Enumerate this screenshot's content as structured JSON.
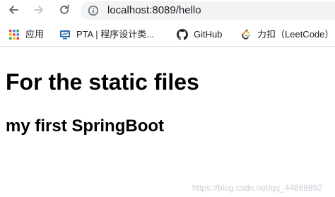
{
  "address_bar": {
    "url": "localhost:8089/hello"
  },
  "bookmarks": [
    {
      "label": "应用",
      "icon": "apps-grid-icon"
    },
    {
      "label": "PTA | 程序设计类...",
      "icon": "pta-favicon-icon"
    },
    {
      "label": "GitHub",
      "icon": "github-icon"
    },
    {
      "label": "力扣（LeetCode）",
      "icon": "leetcode-icon"
    }
  ],
  "page": {
    "heading1": "For the static files",
    "heading2": "my first SpringBoot",
    "watermark": "https://blog.csdn.net/qq_44868892"
  },
  "colors": {
    "omnibox_bg": "#f1f3f4",
    "text": "#202124",
    "heading": "#000000",
    "watermark": "#c8cdd4"
  }
}
